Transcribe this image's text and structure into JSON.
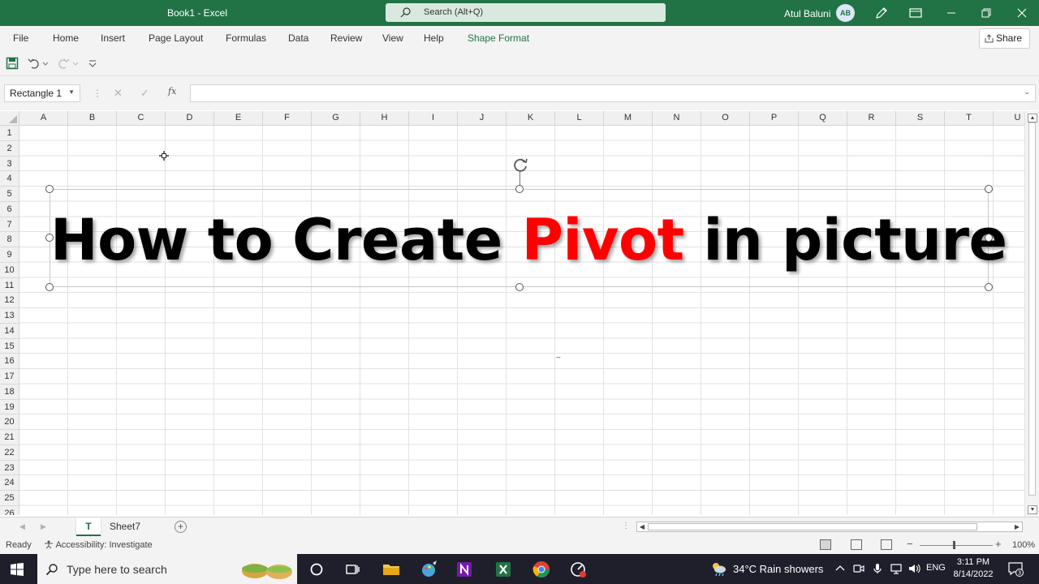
{
  "window": {
    "title": "Book1 - Excel",
    "search_placeholder": "Search (Alt+Q)",
    "user_name": "Atul Baluni",
    "user_initials": "AB"
  },
  "ribbon": {
    "tabs": [
      "File",
      "Home",
      "Insert",
      "Page Layout",
      "Formulas",
      "Data",
      "Review",
      "View",
      "Help",
      "Shape Format"
    ],
    "share_label": "Share"
  },
  "formula_bar": {
    "name_box": "Rectangle 1",
    "fx_label": "fx",
    "formula": ""
  },
  "grid": {
    "columns": [
      "A",
      "B",
      "C",
      "D",
      "E",
      "F",
      "G",
      "H",
      "I",
      "J",
      "K",
      "L",
      "M",
      "N",
      "O",
      "P",
      "Q",
      "R",
      "S",
      "T",
      "U"
    ],
    "rows": [
      "1",
      "2",
      "3",
      "4",
      "5",
      "6",
      "7",
      "8",
      "9",
      "10",
      "11",
      "12",
      "13",
      "14",
      "15",
      "16",
      "17",
      "18",
      "19",
      "20",
      "21",
      "22",
      "23",
      "24",
      "25",
      "26"
    ]
  },
  "shape": {
    "text_before": "How to Create ",
    "text_highlight": "Pivot",
    "text_after": " in picture",
    "highlight_color": "#ff0000"
  },
  "sheets": {
    "tabs": [
      "T",
      "Sheet7"
    ],
    "active": "T"
  },
  "status": {
    "ready": "Ready",
    "accessibility": "Accessibility: Investigate",
    "zoom": "100%"
  },
  "taskbar": {
    "search_placeholder": "Type here to search",
    "weather": "34°C  Rain showers",
    "language": "ENG",
    "time": "3:11 PM",
    "date": "8/14/2022",
    "notification_count": "3"
  },
  "colors": {
    "accent": "#217346",
    "taskbar": "#1f1f2b"
  }
}
